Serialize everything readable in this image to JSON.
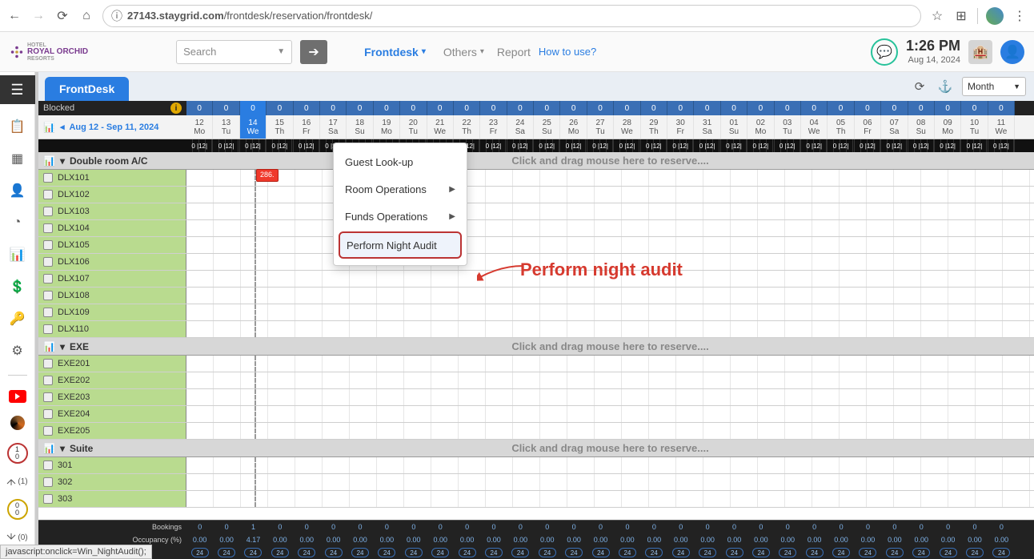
{
  "browser": {
    "url_host": "27143.staygrid.com",
    "url_path": "/frontdesk/reservation/frontdesk/"
  },
  "header": {
    "logo_line1": "HOTEL",
    "logo_line2": "ROYAL ORCHID",
    "logo_line3": "RESORTS",
    "search_placeholder": "Search",
    "menu_frontdesk": "Frontdesk",
    "menu_others": "Others",
    "menu_report": "Report",
    "menu_howto": "How to use?",
    "time": "1:26 PM",
    "date": "Aug 14, 2024"
  },
  "dropdown": {
    "items": [
      {
        "label": "Guest Look-up",
        "sub": false
      },
      {
        "label": "Room Operations",
        "sub": true
      },
      {
        "label": "Funds Operations",
        "sub": true
      },
      {
        "label": "Perform Night Audit",
        "sub": false,
        "highlight": true
      }
    ]
  },
  "annotation": "Perform night audit",
  "tab": {
    "label": "FrontDesk",
    "view": "Month"
  },
  "date_range": "Aug 12 - Sep 11, 2024",
  "blocked_label": "Blocked",
  "days": [
    {
      "num": "12",
      "dow": "Mo"
    },
    {
      "num": "13",
      "dow": "Tu"
    },
    {
      "num": "14",
      "dow": "We",
      "hl": true
    },
    {
      "num": "15",
      "dow": "Th"
    },
    {
      "num": "16",
      "dow": "Fr"
    },
    {
      "num": "17",
      "dow": "Sa"
    },
    {
      "num": "18",
      "dow": "Su"
    },
    {
      "num": "19",
      "dow": "Mo"
    },
    {
      "num": "20",
      "dow": "Tu"
    },
    {
      "num": "21",
      "dow": "We"
    },
    {
      "num": "22",
      "dow": "Th"
    },
    {
      "num": "23",
      "dow": "Fr"
    },
    {
      "num": "24",
      "dow": "Sa"
    },
    {
      "num": "25",
      "dow": "Su"
    },
    {
      "num": "26",
      "dow": "Mo"
    },
    {
      "num": "27",
      "dow": "Tu"
    },
    {
      "num": "28",
      "dow": "We"
    },
    {
      "num": "29",
      "dow": "Th"
    },
    {
      "num": "30",
      "dow": "Fr"
    },
    {
      "num": "31",
      "dow": "Sa"
    },
    {
      "num": "01",
      "dow": "Su"
    },
    {
      "num": "02",
      "dow": "Mo"
    },
    {
      "num": "03",
      "dow": "Tu"
    },
    {
      "num": "04",
      "dow": "We"
    },
    {
      "num": "05",
      "dow": "Th"
    },
    {
      "num": "06",
      "dow": "Fr"
    },
    {
      "num": "07",
      "dow": "Sa"
    },
    {
      "num": "08",
      "dow": "Su"
    },
    {
      "num": "09",
      "dow": "Mo"
    },
    {
      "num": "10",
      "dow": "Tu"
    },
    {
      "num": "11",
      "dow": "We"
    }
  ],
  "time_label": "0 |12|",
  "sections": [
    {
      "name": "Double room A/C",
      "hint": "Click and drag mouse here to reserve....",
      "rooms": [
        "DLX101",
        "DLX102",
        "DLX103",
        "DLX104",
        "DLX105",
        "DLX106",
        "DLX107",
        "DLX108",
        "DLX109",
        "DLX110"
      ]
    },
    {
      "name": "EXE",
      "hint": "Click and drag mouse here to reserve....",
      "rooms": [
        "EXE201",
        "EXE202",
        "EXE203",
        "EXE204",
        "EXE205"
      ]
    },
    {
      "name": "Suite",
      "hint": "Click and drag mouse here to reserve....",
      "rooms": [
        "301",
        "302",
        "303"
      ]
    }
  ],
  "booking_badge": "286.",
  "footer": {
    "row1_label": "Bookings",
    "row2_label": "Occupancy (%)",
    "bookings": [
      "0",
      "0",
      "1",
      "0",
      "0",
      "0",
      "0",
      "0",
      "0",
      "0",
      "0",
      "0",
      "0",
      "0",
      "0",
      "0",
      "0",
      "0",
      "0",
      "0",
      "0",
      "0",
      "0",
      "0",
      "0",
      "0",
      "0",
      "0",
      "0",
      "0",
      "0"
    ],
    "occupancy": [
      "0.00",
      "0.00",
      "4.17",
      "0.00",
      "0.00",
      "0.00",
      "0.00",
      "0.00",
      "0.00",
      "0.00",
      "0.00",
      "0.00",
      "0.00",
      "0.00",
      "0.00",
      "0.00",
      "0.00",
      "0.00",
      "0.00",
      "0.00",
      "0.00",
      "0.00",
      "0.00",
      "0.00",
      "0.00",
      "0.00",
      "0.00",
      "0.00",
      "0.00",
      "0.00",
      "0.00"
    ],
    "avail": [
      "24",
      "24",
      "24",
      "24",
      "24",
      "24",
      "24",
      "24",
      "24",
      "24",
      "24",
      "24",
      "24",
      "24",
      "24",
      "24",
      "24",
      "24",
      "24",
      "24",
      "24",
      "24",
      "24",
      "24",
      "24",
      "24",
      "24",
      "24",
      "24",
      "24",
      "24"
    ]
  },
  "rail_badges": {
    "b1_top": "1",
    "b1_bot": "0",
    "arr_count": "(1)",
    "b2_top": "0",
    "b2_bot": "0",
    "dep_count": "(0)"
  },
  "status_bar": "javascript:onclick=Win_NightAudit();"
}
